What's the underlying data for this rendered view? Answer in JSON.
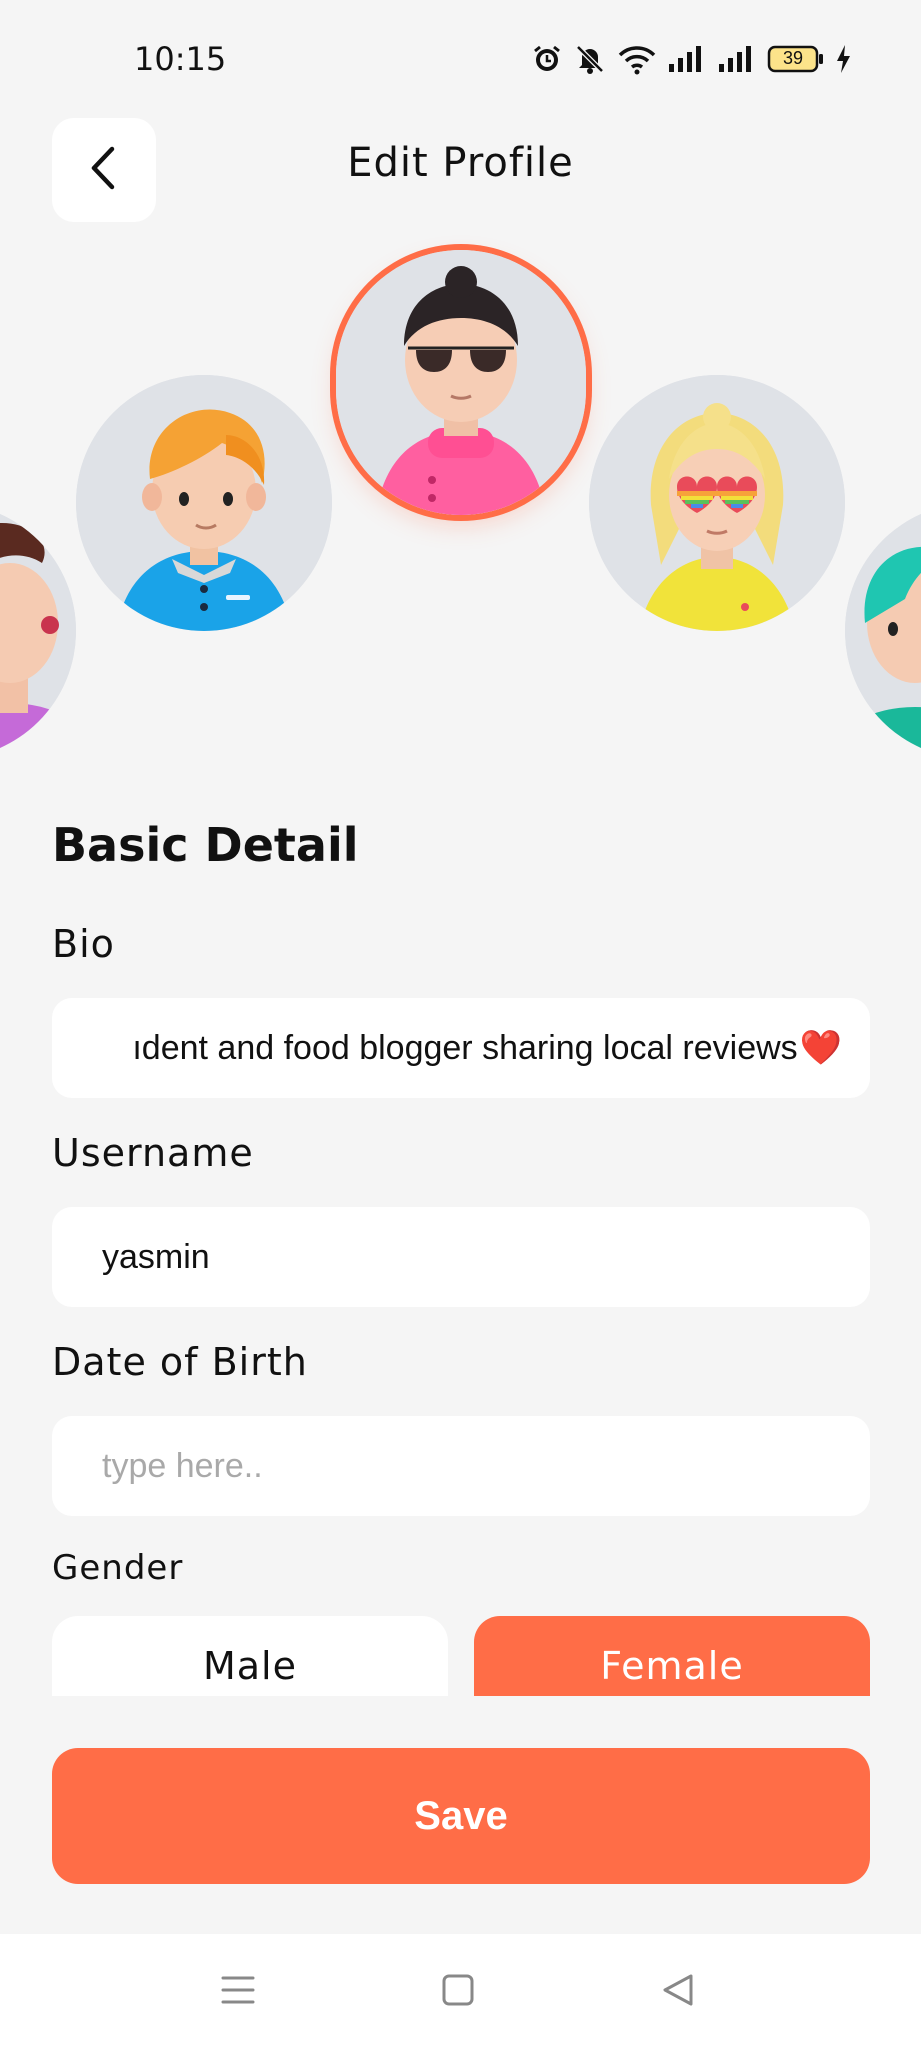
{
  "status_bar": {
    "time": "10:15",
    "battery": "39",
    "icons": [
      "alarm-icon",
      "muted-bell-icon",
      "wifi-icon",
      "signal-icon",
      "signal-icon",
      "battery-icon",
      "charging-icon"
    ]
  },
  "header": {
    "title": "Edit Profile",
    "back_icon": "chevron-left-icon"
  },
  "avatars": [
    {
      "name": "avatar-partial-left",
      "selected": false
    },
    {
      "name": "avatar-orange-hair-boy",
      "selected": false
    },
    {
      "name": "avatar-sunglasses-bun",
      "selected": true
    },
    {
      "name": "avatar-blonde-rainbow-glasses",
      "selected": false
    },
    {
      "name": "avatar-partial-right",
      "selected": false
    }
  ],
  "form": {
    "section_title": "Basic Detail",
    "bio": {
      "label": "Bio",
      "value": "ıdent and food blogger sharing local reviews",
      "emoji": "❤️"
    },
    "username": {
      "label": "Username",
      "value": "yasmin"
    },
    "dob": {
      "label": "Date of Birth",
      "placeholder": "type here.."
    },
    "gender": {
      "label": "Gender",
      "options": [
        "Male",
        "Female"
      ],
      "selected": "Female"
    }
  },
  "actions": {
    "save_label": "Save"
  },
  "colors": {
    "accent": "#ff6d47",
    "background": "#f5f5f5",
    "surface": "#ffffff"
  },
  "nav_bar": {
    "icons": [
      "menu-icon",
      "home-square-icon",
      "back-triangle-icon"
    ]
  }
}
